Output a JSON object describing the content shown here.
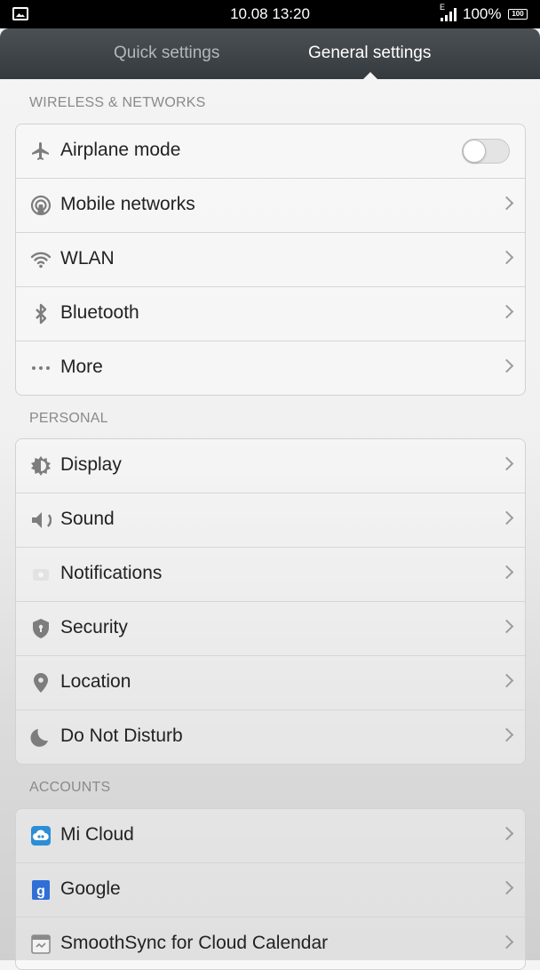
{
  "status_bar": {
    "time": "10.08 13:20",
    "network_type": "E",
    "battery_percent": "100%",
    "battery_icon_text": "100"
  },
  "tabs": [
    {
      "label": "Quick settings",
      "selected": false
    },
    {
      "label": "General settings",
      "selected": true
    }
  ],
  "sections": {
    "wireless": {
      "header": "WIRELESS & NETWORKS",
      "items": [
        {
          "label": "Airplane mode",
          "icon": "airplane-icon",
          "control": "toggle",
          "toggle_on": false
        },
        {
          "label": "Mobile networks",
          "icon": "mobile-networks-icon",
          "control": "chevron"
        },
        {
          "label": "WLAN",
          "icon": "wifi-icon",
          "control": "chevron"
        },
        {
          "label": "Bluetooth",
          "icon": "bluetooth-icon",
          "control": "chevron"
        },
        {
          "label": "More",
          "icon": "more-dots-icon",
          "control": "chevron"
        }
      ]
    },
    "personal": {
      "header": "PERSONAL",
      "items": [
        {
          "label": "Display",
          "icon": "display-brightness-icon",
          "control": "chevron"
        },
        {
          "label": "Sound",
          "icon": "sound-icon",
          "control": "chevron"
        },
        {
          "label": "Notifications",
          "icon": "notifications-icon",
          "control": "chevron"
        },
        {
          "label": "Security",
          "icon": "shield-icon",
          "control": "chevron"
        },
        {
          "label": "Location",
          "icon": "location-pin-icon",
          "control": "chevron"
        },
        {
          "label": "Do Not Disturb",
          "icon": "moon-icon",
          "control": "chevron"
        }
      ]
    },
    "accounts": {
      "header": "ACCOUNTS",
      "items": [
        {
          "label": "Mi Cloud",
          "icon": "mi-cloud-icon",
          "control": "chevron"
        },
        {
          "label": "Google",
          "icon": "google-icon",
          "control": "chevron"
        },
        {
          "label": "SmoothSync for Cloud Calendar",
          "icon": "calendar-sync-icon",
          "control": "chevron"
        }
      ]
    }
  },
  "colors": {
    "header_bg": "#3f4448",
    "tab_active": "#ffffff",
    "tab_inactive": "#b4b8bb",
    "icon_gray": "#7d7d7d",
    "mi_cloud_blue": "#2d8ed6",
    "google_blue": "#2f6fd6"
  }
}
